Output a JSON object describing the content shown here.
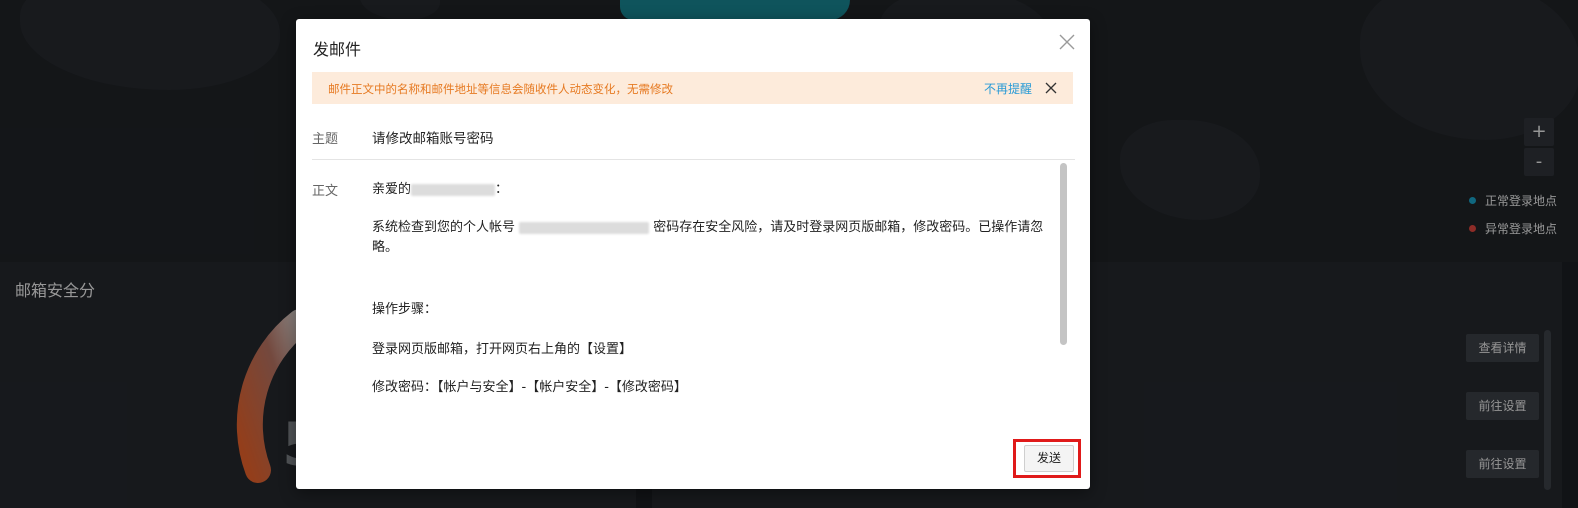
{
  "background": {
    "map": {
      "zoom_in_label": "+",
      "zoom_out_label": "-",
      "legend": [
        {
          "label": "正常登录地点",
          "color": "#1a9fc4"
        },
        {
          "label": "异常登录地点",
          "color": "#d9443c"
        }
      ]
    },
    "score_panel": {
      "title": "邮箱安全分",
      "score_partial": "5"
    },
    "actions": {
      "view_details": "查看详情",
      "go_settings_1": "前往设置",
      "go_settings_2": "前往设置"
    }
  },
  "modal": {
    "title": "发邮件",
    "close_icon": "close-icon",
    "notice": {
      "text": "邮件正文中的名称和邮件地址等信息会随收件人动态变化，无需修改",
      "dismiss_link": "不再提醒",
      "color": "#e67a22",
      "background": "#fdebdb"
    },
    "subject": {
      "label": "主题",
      "value": "请修改邮箱账号密码"
    },
    "body": {
      "label": "正文",
      "greeting_prefix": "亲爱的",
      "greeting_suffix": "：",
      "line1_prefix": "系统检查到您的个人帐号",
      "line1_suffix": "密码存在安全风险，请及时登录网页版邮箱，修改密码。已操作请忽略。",
      "steps_title": "操作步骤：",
      "step1": "登录网页版邮箱，打开网页右上角的【设置】",
      "step2": "修改密码：【帐户与安全】-【帐户安全】-【修改密码】"
    },
    "send_button": "发送",
    "highlight_color": "#e01a1a"
  }
}
